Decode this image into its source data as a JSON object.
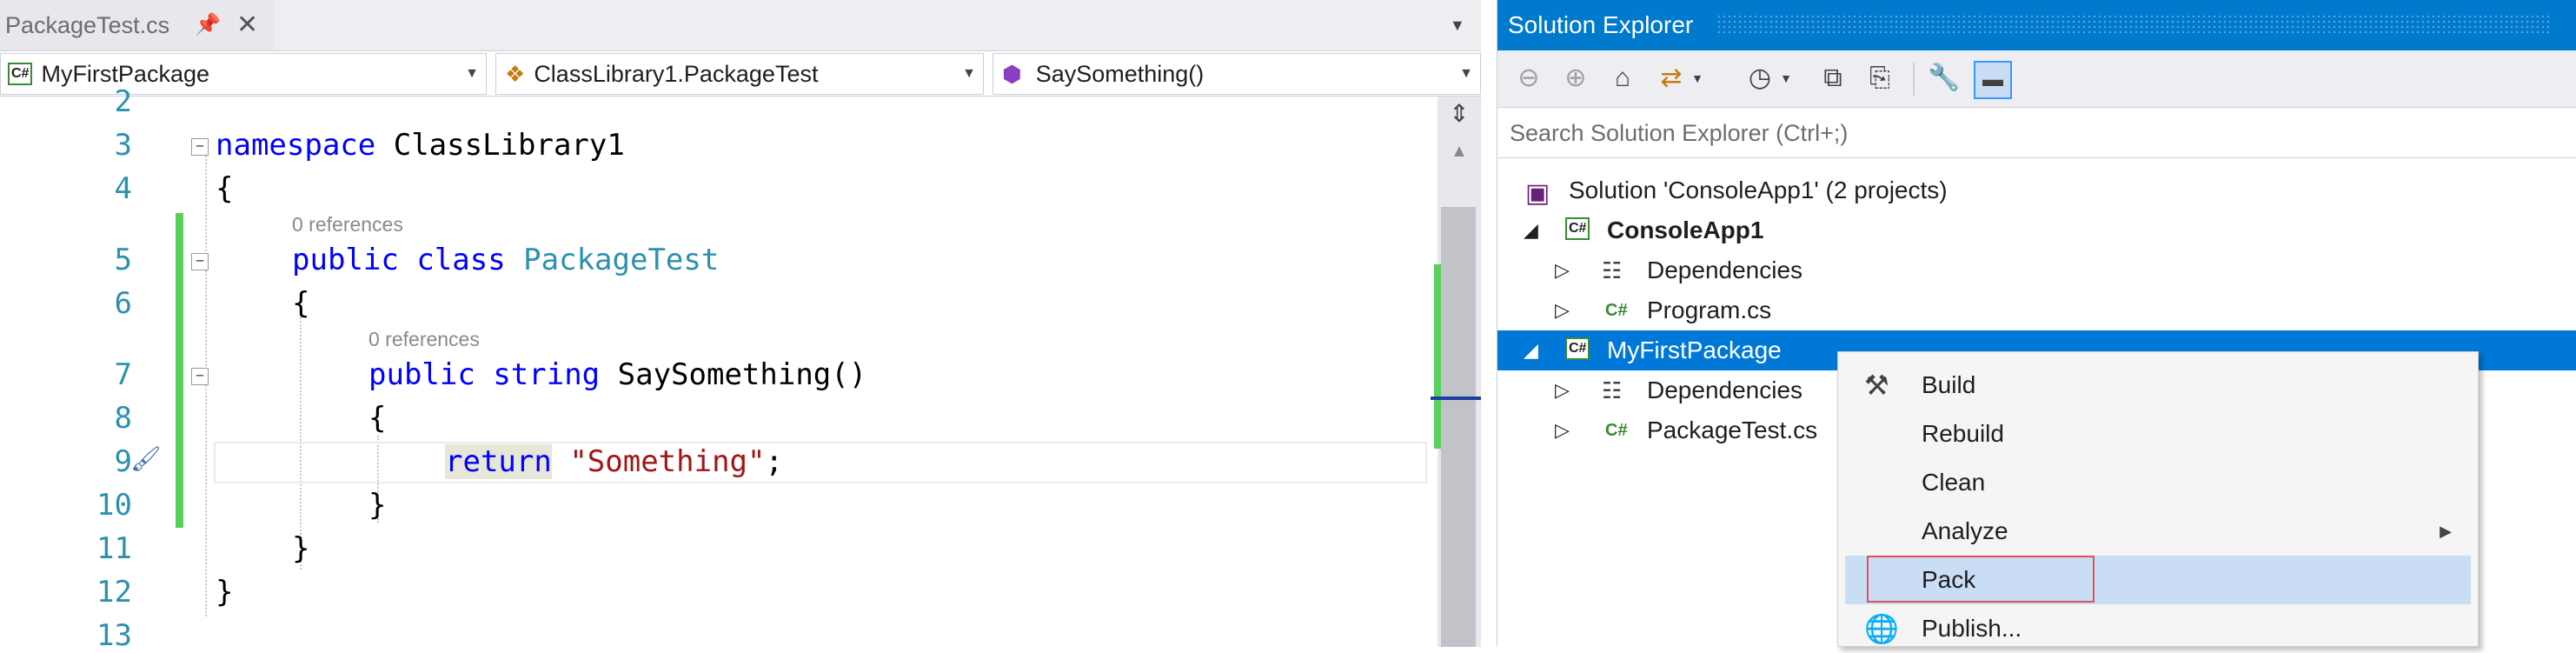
{
  "editor": {
    "tab": {
      "title": "PackageTest.cs",
      "pin_icon": "pin-icon",
      "close_icon": "close-icon"
    },
    "nav": {
      "project": "MyFirstPackage",
      "project_badge": "C#",
      "class": "ClassLibrary1.PackageTest",
      "member": "SaySomething()"
    },
    "lines": [
      {
        "num": "2",
        "code": ""
      },
      {
        "num": "3",
        "code": "namespace ClassLibrary1"
      },
      {
        "num": "4",
        "code": "{"
      },
      {
        "num": "5",
        "code": "public class PackageTest",
        "refs": "0 references"
      },
      {
        "num": "6",
        "code": "{"
      },
      {
        "num": "7",
        "code": "public string SaySomething()",
        "refs": "0 references"
      },
      {
        "num": "8",
        "code": "{"
      },
      {
        "num": "9",
        "code": "return \"Something\";"
      },
      {
        "num": "10",
        "code": "}"
      },
      {
        "num": "11",
        "code": "}"
      },
      {
        "num": "12",
        "code": "}"
      },
      {
        "num": "13",
        "code": ""
      }
    ],
    "tokens": {
      "namespace_kw": "namespace",
      "namespace_name": "ClassLibrary1",
      "public_kw": "public",
      "class_kw": "class",
      "class_name": "PackageTest",
      "string_kw": "string",
      "method_name": "SaySomething()",
      "return_kw": "return",
      "string_literal": "\"Something\"",
      "semicolon": ";",
      "open_brace": "{",
      "close_brace": "}"
    },
    "colors": {
      "keyword": "#0000ff",
      "type": "#2b91af",
      "string": "#a31515",
      "change_bar": "#57d15b"
    }
  },
  "solution_explorer": {
    "title": "Solution Explorer",
    "search_placeholder": "Search Solution Explorer (Ctrl+;)",
    "tree": [
      {
        "label": "Solution 'ConsoleApp1' (2 projects)"
      },
      {
        "label": "ConsoleApp1",
        "badge": "C#"
      },
      {
        "label": "Dependencies"
      },
      {
        "label": "Program.cs",
        "badge": "C#"
      },
      {
        "label": "MyFirstPackage",
        "badge": "C#",
        "selected": true
      },
      {
        "label": "Dependencies"
      },
      {
        "label": "PackageTest.cs",
        "badge": "C#"
      }
    ],
    "accent": "#007acc"
  },
  "context_menu": {
    "items": [
      {
        "label": "Build",
        "icon": "build-icon"
      },
      {
        "label": "Rebuild"
      },
      {
        "label": "Clean"
      },
      {
        "label": "Analyze",
        "submenu_arrow": "▶"
      },
      {
        "label": "Pack",
        "highlighted": true
      },
      {
        "label": "Publish...",
        "icon": "publish-icon"
      }
    ]
  }
}
